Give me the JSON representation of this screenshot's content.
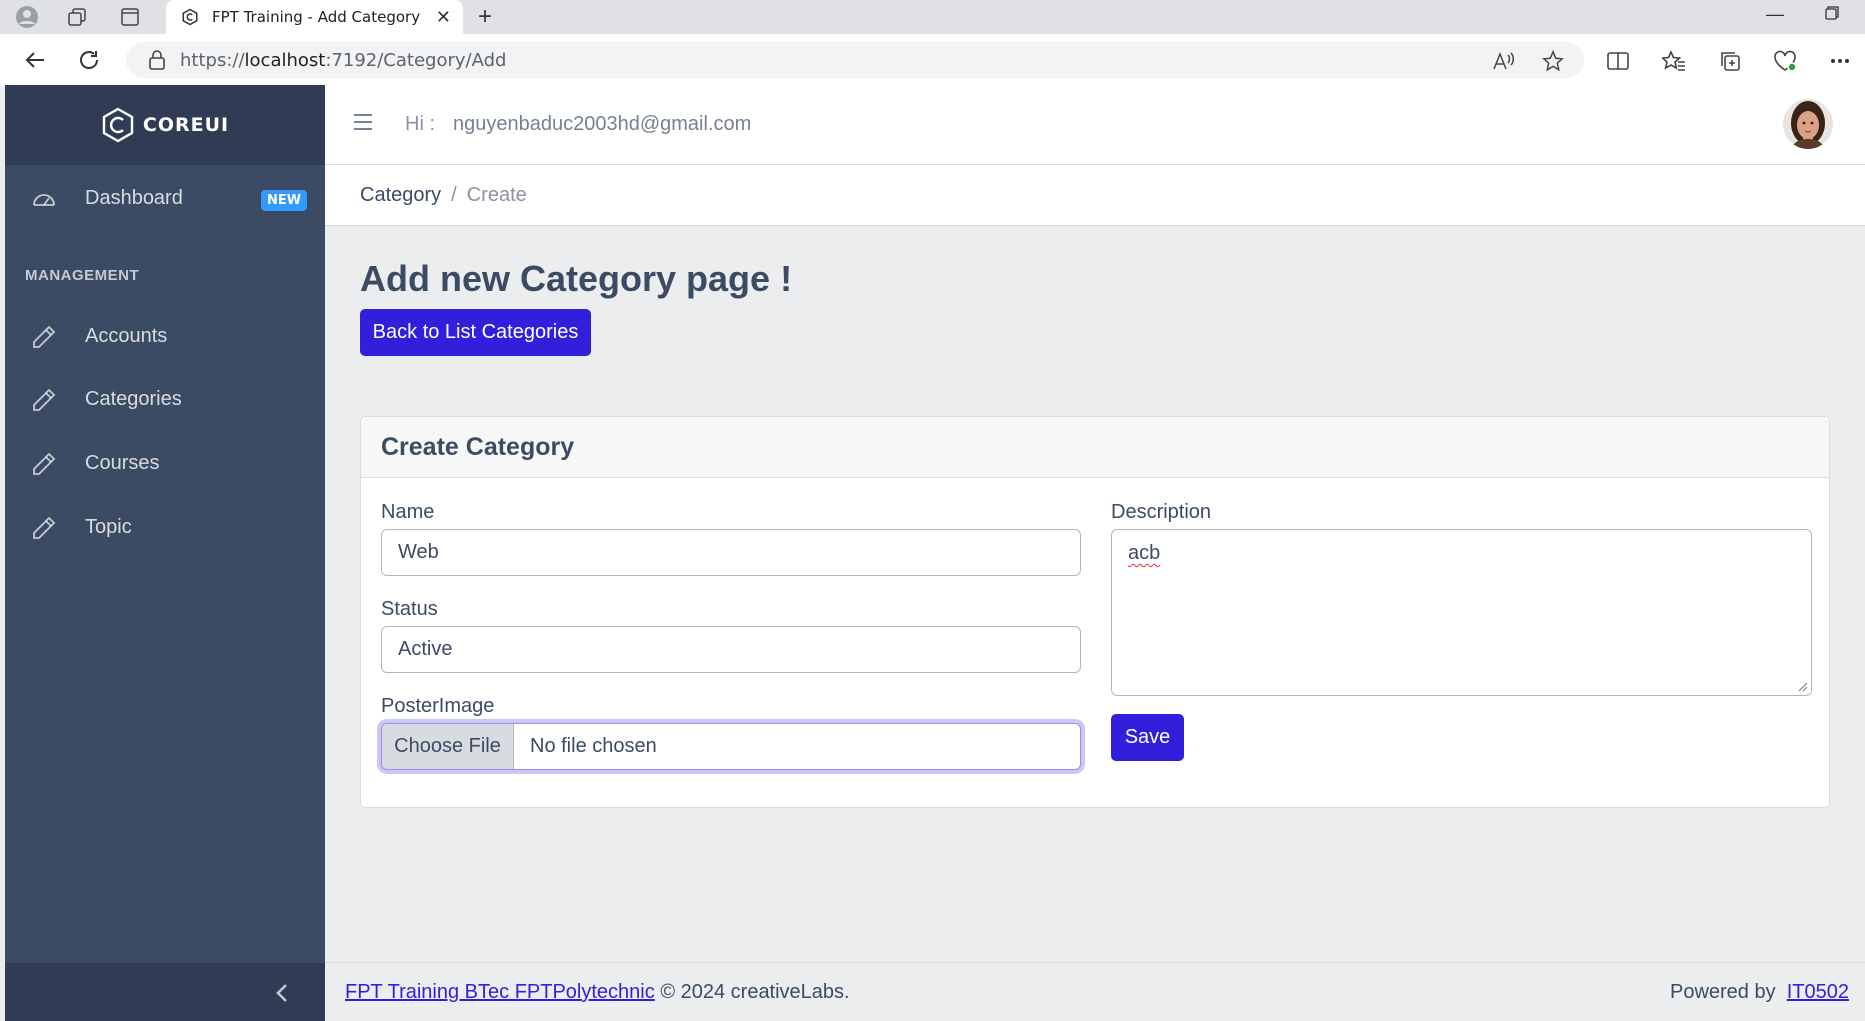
{
  "browser": {
    "tab_title": "FPT Training - Add Category",
    "url_prefix": "https://",
    "url_host": "localhost",
    "url_rest": ":7192/Category/Add"
  },
  "sidebar": {
    "brand": "COREUI",
    "items": [
      {
        "label": "Dashboard",
        "icon": "speedometer-icon",
        "badge": "NEW"
      },
      {
        "label": "Accounts",
        "icon": "pencil-icon"
      },
      {
        "label": "Categories",
        "icon": "pencil-icon"
      },
      {
        "label": "Courses",
        "icon": "pencil-icon"
      },
      {
        "label": "Topic",
        "icon": "pencil-icon"
      }
    ],
    "section_title": "MANAGEMENT"
  },
  "header": {
    "greeting": "Hi :",
    "email": "nguyenbaduc2003hd@gmail.com"
  },
  "breadcrumb": {
    "items": [
      "Category",
      "Create"
    ],
    "separator": "/"
  },
  "main": {
    "title": "Add new Category page !",
    "back_button": "Back to List Categories"
  },
  "form": {
    "card_title": "Create Category",
    "name_label": "Name",
    "name_value": "Web",
    "status_label": "Status",
    "status_value": "Active",
    "poster_label": "PosterImage",
    "file_button": "Choose File",
    "file_status": "No file chosen",
    "description_label": "Description",
    "description_value": "acb",
    "save_button": "Save"
  },
  "footer": {
    "left_link": "FPT Training BTec FPTPolytechnic",
    "left_text": "© 2024 creativeLabs.",
    "right_text": "Powered by",
    "right_link": "IT0502"
  },
  "colors": {
    "primary": "#321fdb",
    "sidebar": "#3c4b64",
    "sidebar_dark": "#303c54",
    "badge": "#3399ff"
  }
}
